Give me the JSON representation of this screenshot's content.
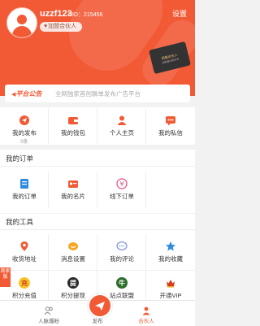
{
  "header": {
    "username": "uzzf123",
    "uid": "UID：215456",
    "join_label": "加盟合伙人",
    "settings_label": "设置",
    "card_title": "招募合伙人",
    "card_sub": "成就事业新机会"
  },
  "notice": {
    "tag": "平台公告",
    "text": "全网独家首创聊单发布广告平台"
  },
  "quick": [
    {
      "label": "我的发布",
      "sub": "0条",
      "icon": "publish-icon"
    },
    {
      "label": "我的钱包",
      "icon": "wallet-icon"
    },
    {
      "label": "个人主页",
      "icon": "person-icon"
    },
    {
      "label": "我的私信",
      "icon": "message-icon"
    }
  ],
  "orders": {
    "title": "我的订单",
    "items": [
      {
        "label": "我的订单",
        "icon": "order-icon"
      },
      {
        "label": "我的名片",
        "icon": "card-icon"
      },
      {
        "label": "线下订单",
        "icon": "yen-icon"
      }
    ]
  },
  "tools": {
    "title": "我的工具",
    "row1": [
      {
        "label": "收货地址",
        "icon": "location-icon"
      },
      {
        "label": "消息设置",
        "icon": "message-settings-icon"
      },
      {
        "label": "我的评论",
        "icon": "comment-icon"
      },
      {
        "label": "我的收藏",
        "icon": "star-icon"
      }
    ],
    "row2": [
      {
        "label": "积分充值",
        "glyph": "充",
        "icon": "recharge-icon"
      },
      {
        "label": "积分提现",
        "glyph": "提",
        "icon": "withdraw-icon"
      },
      {
        "label": "站点联盟",
        "glyph": "牛",
        "icon": "league-icon"
      },
      {
        "label": "开通VIP",
        "icon": "vip-icon"
      }
    ]
  },
  "side_badge": "商家版",
  "tabbar": {
    "left": "人脉爆粉",
    "center": "发布",
    "right": "合伙人"
  },
  "colors": {
    "accent": "#f25a36"
  }
}
